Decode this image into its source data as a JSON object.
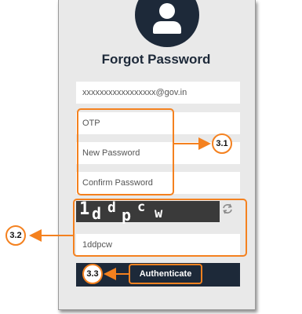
{
  "form": {
    "title": "Forgot Password",
    "email_value": "xxxxxxxxxxxxxxxxx@gov.in",
    "otp_placeholder": "OTP",
    "new_password_placeholder": "New Password",
    "confirm_password_placeholder": "Confirm Password",
    "captcha_text": "1ddpcw",
    "captcha_chars": [
      "1",
      "d",
      "d",
      "p",
      "c",
      "w"
    ],
    "captcha_input_value": "1ddpcw",
    "authenticate_label": "Authenticate"
  },
  "annotations": {
    "callout_1": "3.1",
    "callout_2": "3.2",
    "callout_3": "3.3",
    "highlight_color": "#f4811f"
  },
  "icons": {
    "avatar": "user-avatar-icon",
    "refresh": "refresh-captcha-icon"
  },
  "colors": {
    "navy": "#1d2939",
    "card_bg": "#e9e9e9",
    "accent": "#f4811f"
  }
}
